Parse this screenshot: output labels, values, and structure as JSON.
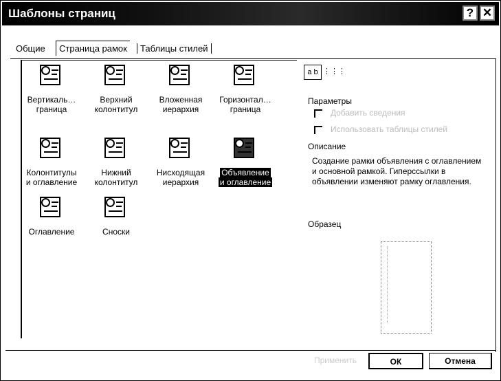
{
  "window": {
    "title": "Шаблоны страниц",
    "help_glyph": "?",
    "close_glyph": "✕"
  },
  "tabs": [
    "Общие",
    "Страница рамок",
    "Таблицы стилей"
  ],
  "templates": [
    {
      "label1": "Вертикаль…",
      "label2": "граница"
    },
    {
      "label1": "Верхний",
      "label2": "колонтитул"
    },
    {
      "label1": "Вложенная",
      "label2": "иерархия"
    },
    {
      "label1": "Горизонтал…",
      "label2": "граница"
    },
    {
      "label1": "Колонтитулы",
      "label2": "и оглавление"
    },
    {
      "label1": "Нижний",
      "label2": "колонтитул"
    },
    {
      "label1": "Нисходящая",
      "label2": "иерархия"
    },
    {
      "label1": "Объявление",
      "label2": "и оглавление"
    },
    {
      "label1": "Оглавление",
      "label2": ""
    },
    {
      "label1": "Сноски",
      "label2": ""
    }
  ],
  "selected_template_index": 7,
  "view_buttons": {
    "large_icons": "a b",
    "list": "⋮⋮⋮"
  },
  "parameters": {
    "title": "Параметры",
    "option1": "Добавить сведения",
    "option2": "Использовать таблицы стилей"
  },
  "description": {
    "title": "Описание",
    "text": "Создание рамки объявления с оглавлением и основной рамкой. Гиперссылки в объявлении изменяют рамку оглавления."
  },
  "sample": {
    "title": "Образец"
  },
  "buttons": {
    "apply": "Применить",
    "ok": "ОК",
    "cancel": "Отмена"
  }
}
